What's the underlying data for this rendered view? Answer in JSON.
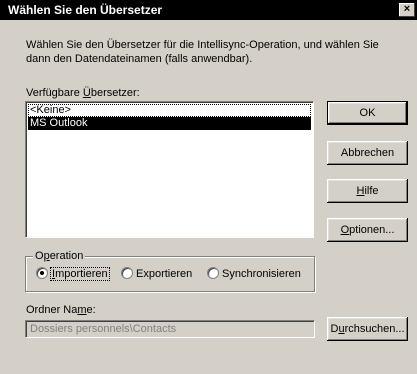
{
  "window": {
    "title": "Wählen Sie den Übersetzer",
    "close_glyph": "×"
  },
  "description": "Wählen Sie den Übersetzer für die Intellisync-Operation, und wählen Sie dann den Datendateinamen (falls anwendbar).",
  "translators": {
    "label_prefix": "Verfügbare ",
    "label_underlined": "Ü",
    "label_suffix": "bersetzer:",
    "items": [
      "<Keine>",
      "MS Outlook"
    ],
    "selected": "MS Outlook"
  },
  "buttons": {
    "ok": "OK",
    "cancel": "Abbrechen",
    "help_u": "H",
    "help_rest": "ilfe",
    "options_u": "O",
    "options_rest": "ptionen...",
    "browse_pre": "D",
    "browse_u": "u",
    "browse_rest": "rchsuchen..."
  },
  "operation": {
    "legend_pre": "O",
    "legend_u": "p",
    "legend_rest": "eration",
    "options": [
      {
        "u": "I",
        "rest": "mportieren",
        "checked": true
      },
      {
        "u": "",
        "rest": "Exportieren",
        "checked": false
      },
      {
        "u": "",
        "rest": "Synchronisieren",
        "checked": false
      }
    ]
  },
  "folder": {
    "label_pre": "Ordner Na",
    "label_u": "m",
    "label_rest": "e:",
    "value": "Dossiers personnels\\Contacts"
  }
}
